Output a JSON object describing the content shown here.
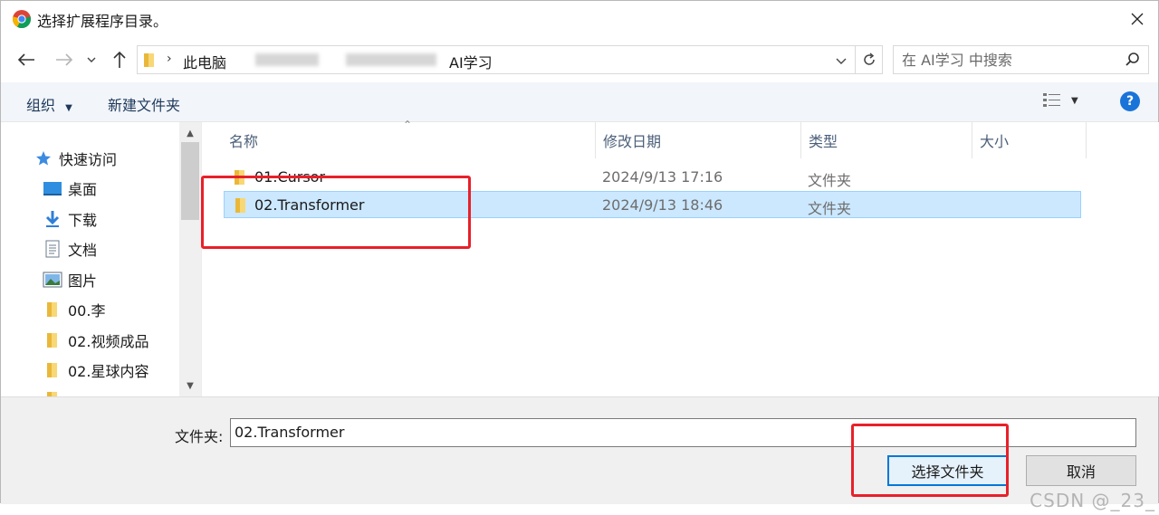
{
  "window": {
    "title": "选择扩展程序目录。"
  },
  "nav": {
    "breadcrumbs": [
      "此电脑",
      "AI学习"
    ],
    "search_placeholder": "在 AI学习 中搜索"
  },
  "toolbar": {
    "organize_label": "组织",
    "new_folder_label": "新建文件夹"
  },
  "sidebar": {
    "items": [
      {
        "label": "快速访问",
        "icon": "star-icon",
        "pinned": false
      },
      {
        "label": "桌面",
        "icon": "desktop-icon",
        "pinned": true
      },
      {
        "label": "下载",
        "icon": "download-icon",
        "pinned": true
      },
      {
        "label": "文档",
        "icon": "document-icon",
        "pinned": true
      },
      {
        "label": "图片",
        "icon": "picture-icon",
        "pinned": true
      },
      {
        "label": "00.李",
        "icon": "folder-icon",
        "pinned": true
      },
      {
        "label": "02.视频成品",
        "icon": "folder-icon",
        "pinned": false
      },
      {
        "label": "02.星球内容",
        "icon": "folder-icon",
        "pinned": false
      }
    ]
  },
  "filelist": {
    "columns": [
      "名称",
      "修改日期",
      "类型",
      "大小"
    ],
    "rows": [
      {
        "name": "01.Cursor",
        "modified": "2024/9/13 17:16",
        "type": "文件夹",
        "size": "",
        "selected": false
      },
      {
        "name": "02.Transformer",
        "modified": "2024/9/13 18:46",
        "type": "文件夹",
        "size": "",
        "selected": true
      }
    ]
  },
  "footer": {
    "folder_label": "文件夹:",
    "folder_value": "02.Transformer",
    "select_button": "选择文件夹",
    "cancel_button": "取消"
  },
  "watermark": "CSDN @_23_",
  "colors": {
    "annotation_red": "#e8202a",
    "selection_blue": "#cce8ff",
    "accent": "#0078d7"
  }
}
